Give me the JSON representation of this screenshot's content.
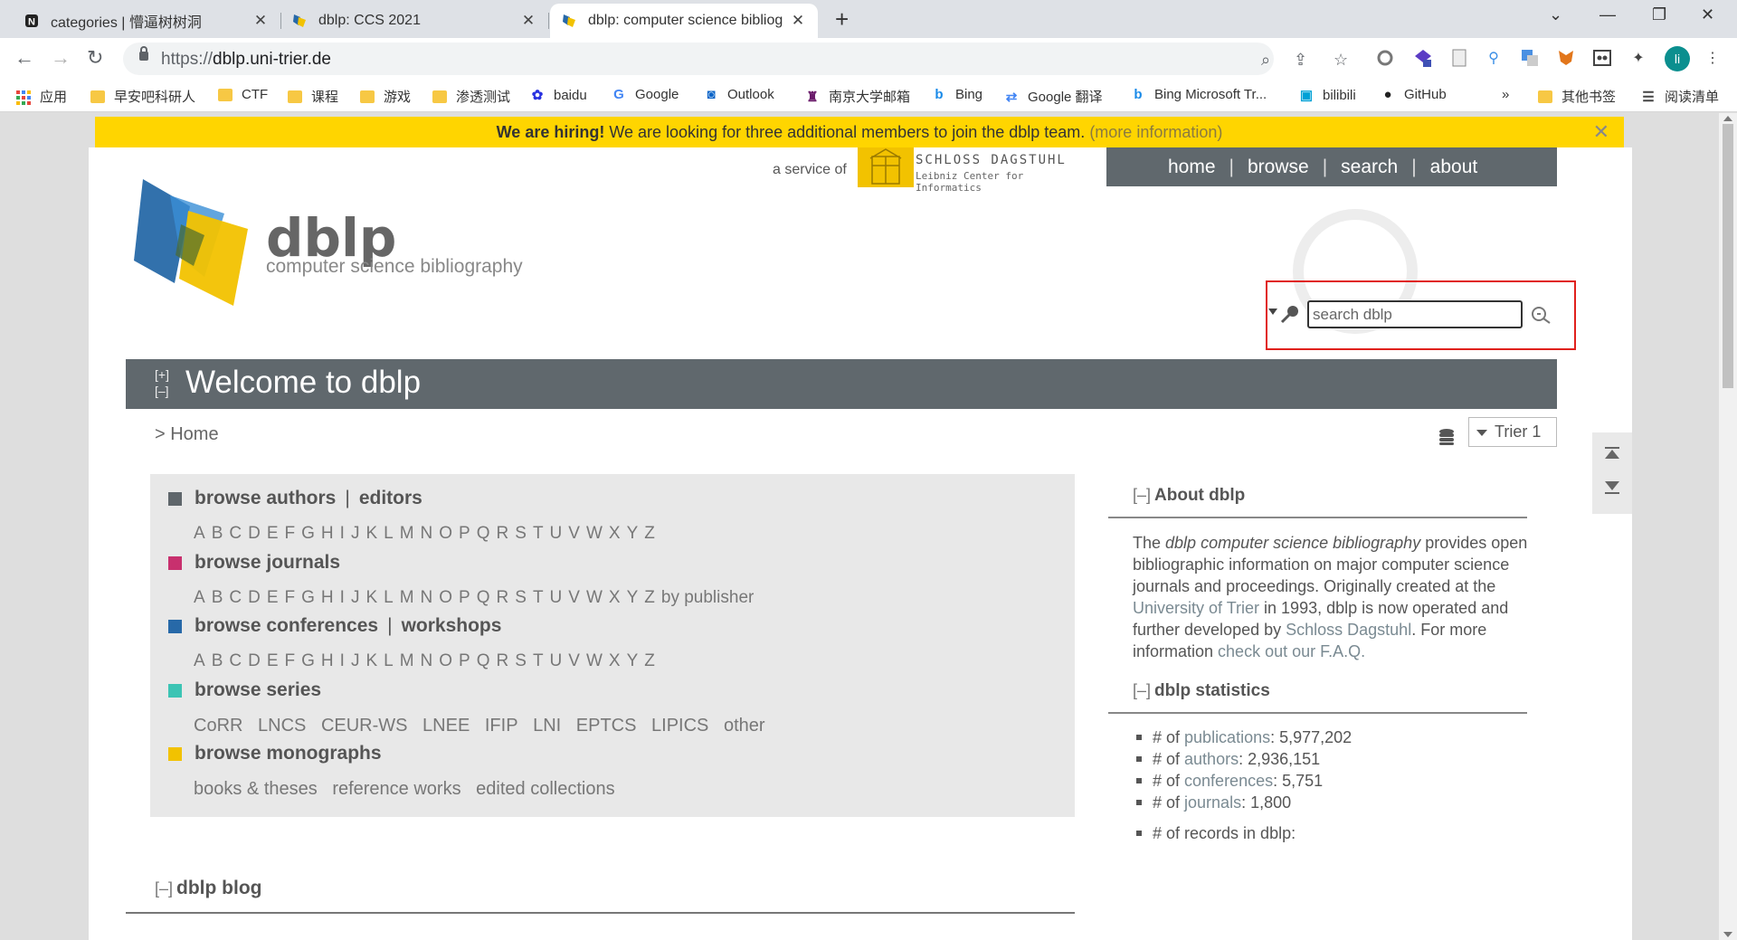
{
  "tabs": [
    {
      "title": "categories | 懵逼树树洞",
      "active": false
    },
    {
      "title": "dblp: CCS 2021",
      "active": false
    },
    {
      "title": "dblp: computer science bibliog",
      "active": true
    }
  ],
  "address_bar": {
    "scheme": "https://",
    "host": "dblp.uni-trier.de"
  },
  "profile_initial": "li",
  "bookmarks": [
    "应用",
    "早安吧科研人",
    "CTF",
    "课程",
    "游戏",
    "渗透测试",
    "baidu",
    "Google",
    "Outlook",
    "南京大学邮箱",
    "Bing",
    "Google 翻译",
    "Bing Microsoft Tr...",
    "bilibili",
    "GitHub",
    "»",
    "其他书签",
    "阅读清单"
  ],
  "banner": {
    "bold": "We are hiring!",
    "text": " We are looking for three additional members to join the dblp team. ",
    "link": "(more information)",
    "close": "✕"
  },
  "header": {
    "service_of": "a service of",
    "dagstuhl_name": "SCHLOSS DAGSTUHL",
    "dagstuhl_sub": "Leibniz Center for Informatics",
    "wordmark": "dblp",
    "tagline": "computer science bibliography",
    "nav": [
      "home",
      "browse",
      "search",
      "about"
    ]
  },
  "search": {
    "placeholder": "search dblp"
  },
  "welcome": {
    "expand": "[+]",
    "collapse": "[–]",
    "title": "Welcome to dblp"
  },
  "breadcrumb": "> Home",
  "mirror": {
    "selected": "Trier 1"
  },
  "browse": {
    "authors": {
      "label": "browse authors",
      "label2": "editors",
      "color": "#5f666b"
    },
    "journals": {
      "label": "browse journals",
      "color": "#c8306e"
    },
    "conferences": {
      "label": "browse conferences",
      "label2": "workshops",
      "color": "#2769a8"
    },
    "series": {
      "label": "browse series",
      "color": "#3cc4b4"
    },
    "monographs": {
      "label": "browse monographs",
      "color": "#f2c200"
    },
    "letters": [
      "A",
      "B",
      "C",
      "D",
      "E",
      "F",
      "G",
      "H",
      "I",
      "J",
      "K",
      "L",
      "M",
      "N",
      "O",
      "P",
      "Q",
      "R",
      "S",
      "T",
      "U",
      "V",
      "W",
      "X",
      "Y",
      "Z"
    ],
    "by_publisher": "by publisher",
    "series_links": [
      "CoRR",
      "LNCS",
      "CEUR-WS",
      "LNEE",
      "IFIP",
      "LNI",
      "EPTCS",
      "LIPICS",
      "other"
    ],
    "monograph_links": [
      "books & theses",
      "reference works",
      "edited collections"
    ]
  },
  "blog": {
    "toggle": "[–]",
    "title": "dblp blog"
  },
  "about_dblp": {
    "toggle": "[–]",
    "title": "About dblp",
    "p1": "The ",
    "p2": "dblp computer science bibliography",
    "p3": " provides open bibliographic information on major computer science journals and proceedings. Originally created at the ",
    "p4": "University of Trier",
    "p5": " in 1993, dblp is now operated and further developed by ",
    "p6": "Schloss Dagstuhl",
    "p7": ". For more information ",
    "p8": "check out our F.A.Q."
  },
  "stats": {
    "toggle": "[–]",
    "title": "dblp statistics",
    "items": [
      {
        "pre": "# of ",
        "link": "publications",
        "value": ": 5,977,202"
      },
      {
        "pre": "# of ",
        "link": "authors",
        "value": ": 2,936,151"
      },
      {
        "pre": "# of ",
        "link": "conferences",
        "value": ": 5,751"
      },
      {
        "pre": "# of ",
        "link": "journals",
        "value": ": 1,800"
      }
    ],
    "records": "# of records in dblp:"
  }
}
